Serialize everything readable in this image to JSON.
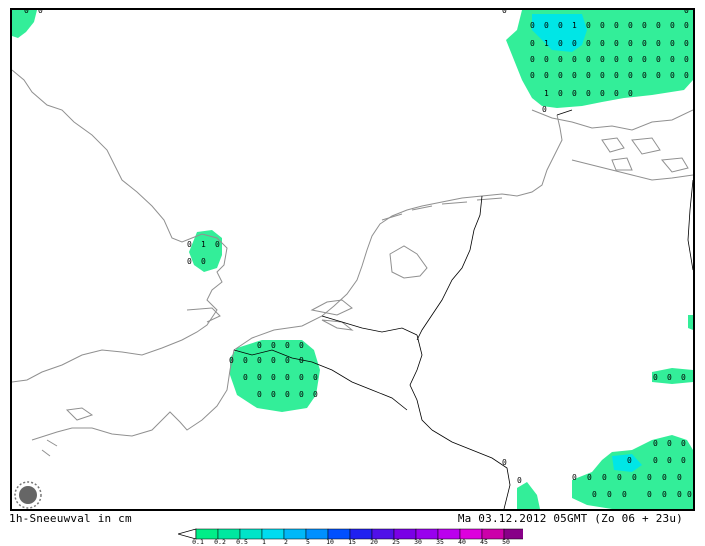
{
  "product_label": "1h-Sneeuwval in cm",
  "valid_time": "Ma 03.12.2012 05GMT (Zo 06 + 23u)",
  "legend": {
    "ticks": [
      "0.1",
      "0.2",
      "0.5",
      "1",
      "2",
      "5",
      "10",
      "15",
      "20",
      "25",
      "30",
      "35",
      "40",
      "45",
      "50"
    ],
    "colors": [
      "#00ee88",
      "#00e8a0",
      "#00e4c8",
      "#00dcf0",
      "#00b8f8",
      "#0090ff",
      "#0050ff",
      "#2020f0",
      "#5010e8",
      "#7a00e6",
      "#9900ee",
      "#bb00ee",
      "#dd00dd",
      "#cc00aa",
      "#880088"
    ]
  },
  "colors": {
    "snow_low": "#33ee99",
    "snow_mid": "#00e8e8",
    "snow_high": "#22ccee",
    "coast": "#909090",
    "border": "#000000"
  },
  "markers": {
    "zero": "0",
    "one": "1"
  }
}
